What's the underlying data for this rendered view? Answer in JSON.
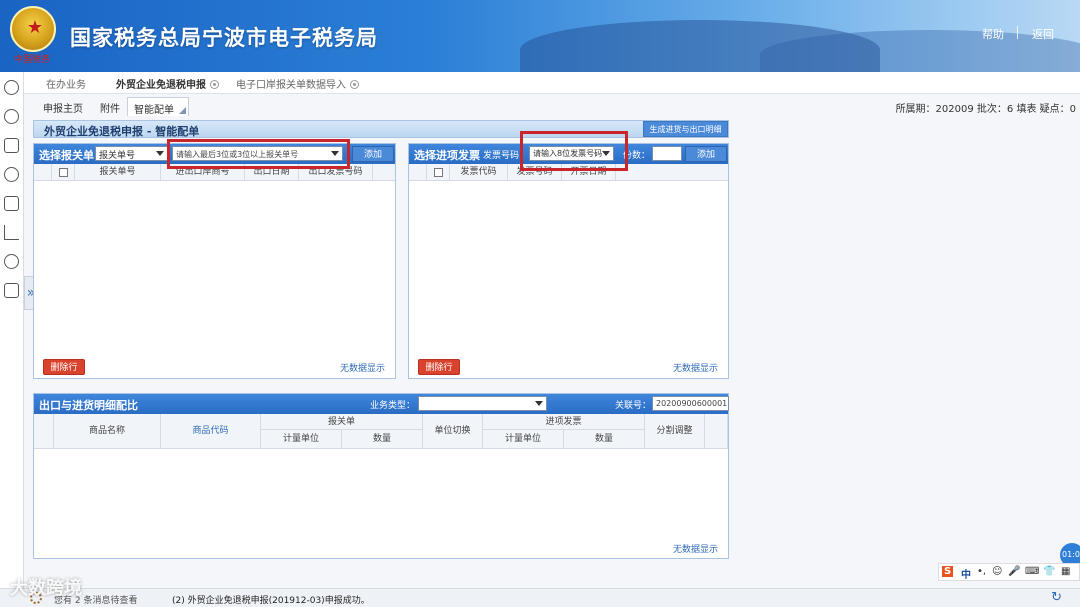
{
  "header": {
    "site_title": "国家税务总局宁波市电子税务局",
    "emblem_text": "中国税务",
    "help": "帮助",
    "back": "返回"
  },
  "top_tabs": [
    {
      "label": "在办业务",
      "active": false,
      "closable": false
    },
    {
      "label": "外贸企业免退税申报",
      "active": true,
      "closable": true
    },
    {
      "label": "电子口岸报关单数据导入",
      "active": false,
      "closable": true
    }
  ],
  "sub_tabs": [
    "申报主页",
    "附件",
    "智能配单"
  ],
  "period_info": "所属期：202009  批次：6  填表  疑点：0",
  "section": {
    "title": "外贸企业免退税申报 - 智能配单",
    "generate_button": "生成进货与出口明细"
  },
  "customs_panel": {
    "label": "选择报关单",
    "type_select": "报关单号",
    "input_placeholder": "请输入最后3位或3位以上报关单号",
    "add_button": "添加",
    "columns": [
      "报关单号",
      "进出口岸商号",
      "出口日期",
      "出口发票号码"
    ],
    "delete_button": "删除行",
    "no_data": "无数据显示"
  },
  "invoice_panel": {
    "label": "选择进项发票",
    "field_label": "发票号码",
    "input_placeholder": "请输入8位发票号码",
    "count_label": "份数：",
    "count_value": "",
    "add_button": "添加",
    "columns": [
      "发票代码",
      "发票号码",
      "开票日期"
    ],
    "delete_button": "删除行",
    "no_data": "无数据显示"
  },
  "detail_panel": {
    "label": "出口与进货明细配比",
    "business_type_label": "业务类型：",
    "business_type_value": "",
    "link_label": "关联号：",
    "link_value": "20200900600001",
    "columns": {
      "product_name": "商品名称",
      "product_code": "商品代码",
      "customs_group": "报关单",
      "unit": "计量单位",
      "quantity": "数量",
      "unit_switch": "单位切换",
      "invoice_group": "进项发票",
      "invoice_unit": "计量单位",
      "invoice_quantity": "数量",
      "split_adjust": "分割调整"
    },
    "no_data": "无数据显示"
  },
  "status_bar": {
    "notice": "您有 2 条消息待查看",
    "message": "(2)  外贸企业免退税申报(201912-03)申报成功。"
  },
  "watermark": "大数跨境",
  "clock": "01:0",
  "ime": [
    "S",
    "中",
    "•,",
    "☺",
    "🎤",
    "⌨",
    "👕",
    "▦"
  ]
}
